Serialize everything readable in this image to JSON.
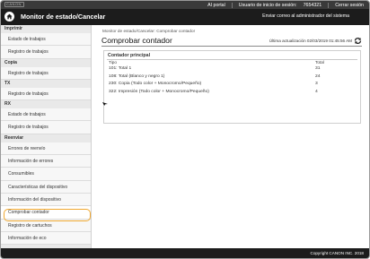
{
  "top_bar": {
    "logo": "CANON",
    "links": [
      "AI portal",
      "Usuario de inicio de sesión:",
      "7654321",
      "Cerrar sesión"
    ]
  },
  "header": {
    "title": "Monitor de estado/Cancelar",
    "email_link": "Enviar correo al administrador del sistema"
  },
  "sidebar": {
    "sections": [
      {
        "title": "Imprimir",
        "items": [
          "Estado de trabajos",
          "Registro de trabajos"
        ]
      },
      {
        "title": "Copia",
        "items": [
          "Registro de trabajos"
        ]
      },
      {
        "title": "TX",
        "items": [
          "Registro de trabajos"
        ]
      },
      {
        "title": "RX",
        "items": [
          "Estado de trabajos",
          "Registro de trabajos"
        ]
      },
      {
        "title": "Reenviar",
        "items": [
          "Errores de reenvío",
          "Información de errores",
          "Consumibles",
          "Características del dispositivo",
          "Información del dispositivo",
          "Comprobar contador",
          "Registro de cartuchos",
          "Información de eco"
        ]
      }
    ],
    "active_item": "Comprobar contador"
  },
  "main": {
    "breadcrumb": "Monitor de estado/Cancelar: Comprobar contador",
    "title": "Comprobar contador",
    "last_updated": "Última actualización 02/03/2019 01:45:56 AM",
    "panel": {
      "title": "Contador principal",
      "col_type": "Tipo",
      "col_total": "Total",
      "rows": [
        {
          "label": "101: Total 1",
          "value": "31"
        },
        {
          "label": "108: Total (Blanco y negro 1)",
          "value": "24"
        },
        {
          "label": "230: Copia (Todo color + Monocromo/Pequeño)",
          "value": "3"
        },
        {
          "label": "322: Impresión (Todo color + Monocromo/Pequeño)",
          "value": "4"
        }
      ]
    }
  },
  "footer": {
    "copyright": "Copyright CANON INC. 2018"
  },
  "colors": {
    "header_bg": "#1c1c1c",
    "highlight": "#f0a830"
  }
}
